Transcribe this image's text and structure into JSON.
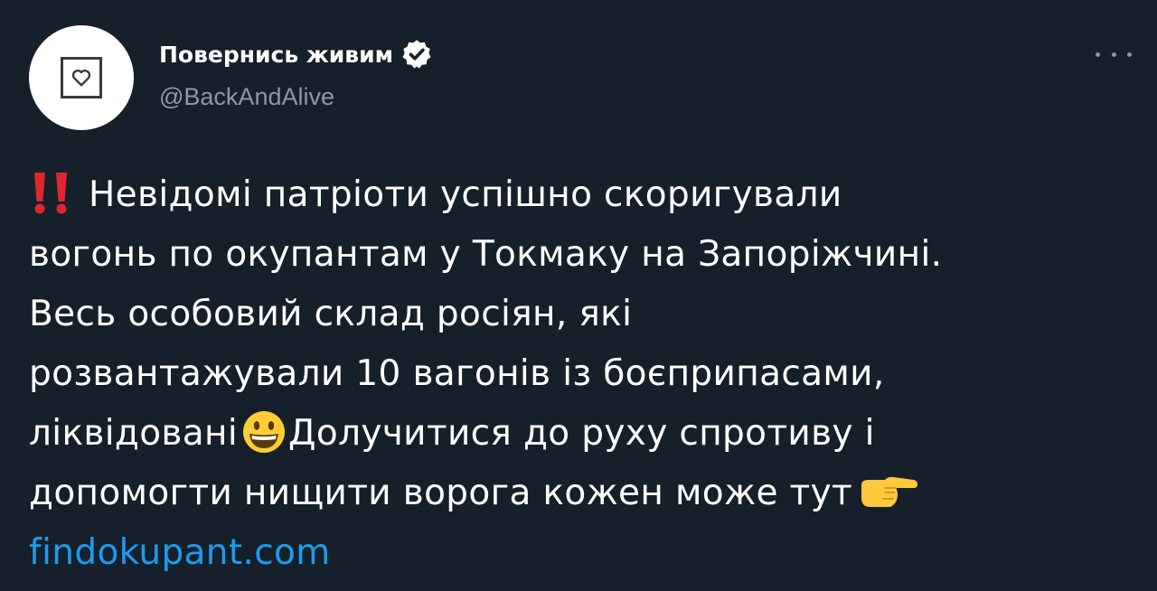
{
  "account": {
    "display_name": "Повернись живим",
    "handle": "@BackAndAlive",
    "verified": true,
    "avatar_icon": "heart-frame-icon"
  },
  "tweet": {
    "line1": "Невідомі патріоти успішно скоригували",
    "line2": "вогонь по окупантам у Токмаку на Запоріжчині.",
    "line3": "Весь особовий склад росіян, які",
    "line4": "розвантажували 10 вагонів із боєприпасами,",
    "line5_a": "ліквідовані",
    "line5_b": "Долучитися до руху спротиву і",
    "line6": "допомогти нищити ворога кожен може тут",
    "link": "findokupant.com",
    "emojis": [
      "double-exclamation-icon",
      "grinning-face-icon",
      "pointing-right-icon"
    ]
  },
  "colors": {
    "background": "#15202b",
    "text": "#ffffff",
    "secondary_text": "#8b98a5",
    "link": "#1d9bf0",
    "verified_badge": "#ffffff"
  }
}
